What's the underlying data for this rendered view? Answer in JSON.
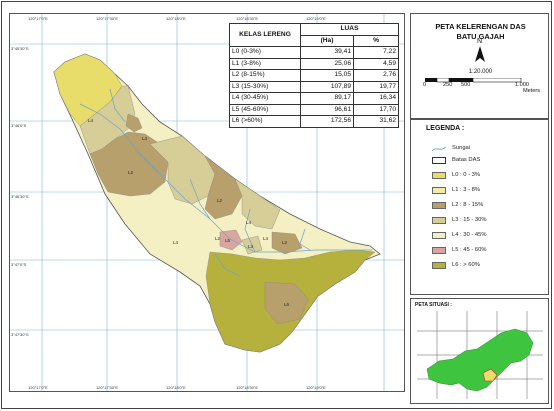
{
  "map": {
    "title_line1": "PETA KELERENGAN DAS",
    "title_line2": "BATU GAJAH",
    "north": "N",
    "scale_ratio": "1:20.000",
    "scale_labels": [
      "0",
      "250",
      "500",
      "1.000"
    ],
    "scale_unit": "Meters",
    "legend_title": "LEGENDA :",
    "legend": [
      {
        "label": "Sungai",
        "color": "#6aa6c8",
        "kind": "line"
      },
      {
        "label": "Batas DAS",
        "color": "#ffffff",
        "kind": "box"
      },
      {
        "label": "L0 : 0 - 3%",
        "color": "#e8dc6b",
        "kind": "box"
      },
      {
        "label": "L1 : 3 - 8%",
        "color": "#f3eaa9",
        "kind": "box"
      },
      {
        "label": "L2 : 8 - 15%",
        "color": "#b8a06c",
        "kind": "box"
      },
      {
        "label": "L3 : 15 - 30%",
        "color": "#d6cd97",
        "kind": "box"
      },
      {
        "label": "L4 : 30 - 45%",
        "color": "#f5efc4",
        "kind": "box"
      },
      {
        "label": "L5 : 45 - 60%",
        "color": "#d7a79f",
        "kind": "box"
      },
      {
        "label": "L6 : > 60%",
        "color": "#b6b03d",
        "kind": "box"
      }
    ],
    "situasi_title": "PETA SITUASI :",
    "polygon_labels": [
      "L4",
      "L4",
      "L2",
      "L4",
      "L2",
      "L4",
      "L2",
      "L5",
      "L3",
      "L4",
      "L2",
      "L6"
    ],
    "x_ticks": [
      "120°17'0\"E",
      "120°17'30\"E",
      "120°18'0\"E",
      "120°18'30\"E",
      "120°19'0\"E"
    ],
    "y_ticks": [
      "3°45'30\"S",
      "3°46'0\"S",
      "3°46'30\"S",
      "3°47'0\"S",
      "3°47'30\"S"
    ]
  },
  "table": {
    "headers": [
      "KELAS LERENG",
      "LUAS",
      "(Ha)",
      "%"
    ],
    "rows": [
      {
        "code": "L0",
        "range": "(0-3%)",
        "ha": "39,41",
        "pct": "7,22"
      },
      {
        "code": "L1",
        "range": "(3-8%)",
        "ha": "25,06",
        "pct": "4,59"
      },
      {
        "code": "L2",
        "range": "(8-15%)",
        "ha": "15,05",
        "pct": "2,76"
      },
      {
        "code": "L3",
        "range": "(15-30%)",
        "ha": "107,89",
        "pct": "19,77"
      },
      {
        "code": "L4",
        "range": "(30-45%)",
        "ha": "89,17",
        "pct": "16,34"
      },
      {
        "code": "L5",
        "range": "(45-60%)",
        "ha": "96,61",
        "pct": "17,70"
      },
      {
        "code": "L6",
        "range": "(>60%)",
        "ha": "172,56",
        "pct": "31,62"
      }
    ]
  }
}
